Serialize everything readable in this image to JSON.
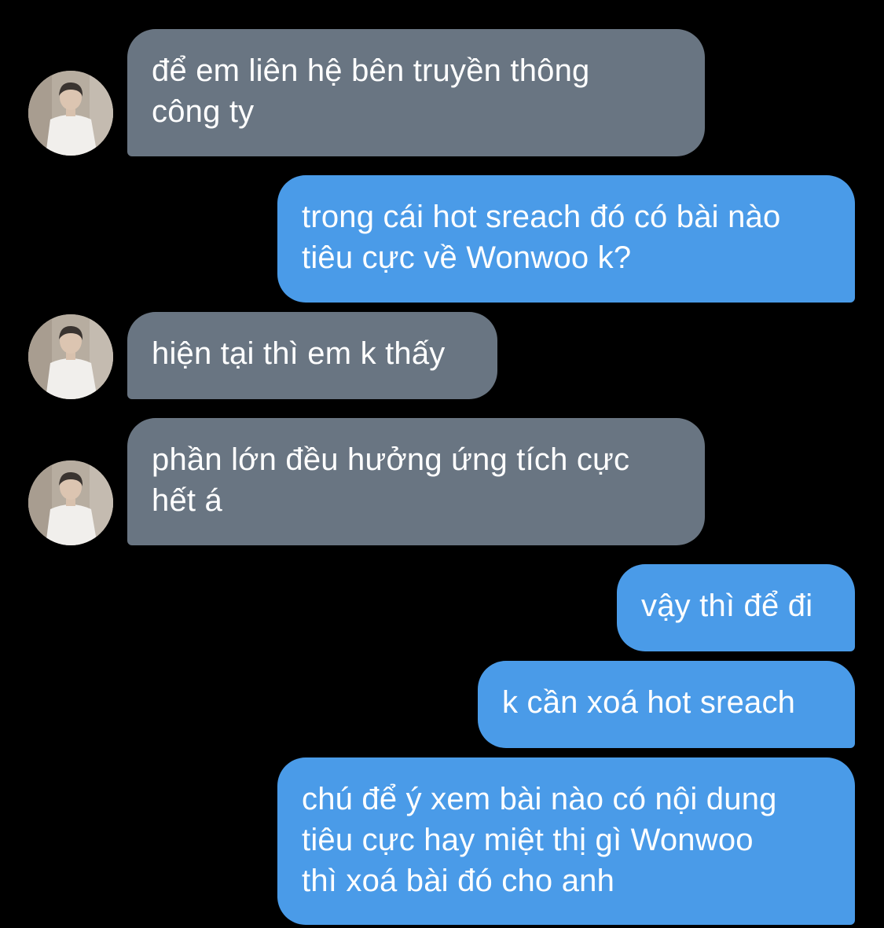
{
  "colors": {
    "background": "#000000",
    "incoming_bubble": "#697582",
    "outgoing_bubble": "#4a9be8",
    "text": "#ffffff"
  },
  "contact": {
    "avatar_icon": "person-photo-avatar"
  },
  "messages": [
    {
      "direction": "incoming",
      "text": "để em liên hệ bên truyền thông\ncông ty"
    },
    {
      "direction": "outgoing",
      "text": "trong cái hot sreach đó có bài nào\ntiêu cực về Wonwoo k?"
    },
    {
      "direction": "incoming",
      "text": "hiện tại thì em k thấy"
    },
    {
      "direction": "incoming",
      "text": "phần lớn đều hưởng ứng tích cực\nhết á"
    },
    {
      "direction": "outgoing",
      "text": "vậy thì để đi"
    },
    {
      "direction": "outgoing",
      "text": "k cần xoá hot sreach"
    },
    {
      "direction": "outgoing",
      "text": "chú để ý xem bài nào có nội dung\ntiêu cực hay miệt thị gì Wonwoo\nthì xoá bài đó cho anh"
    }
  ]
}
